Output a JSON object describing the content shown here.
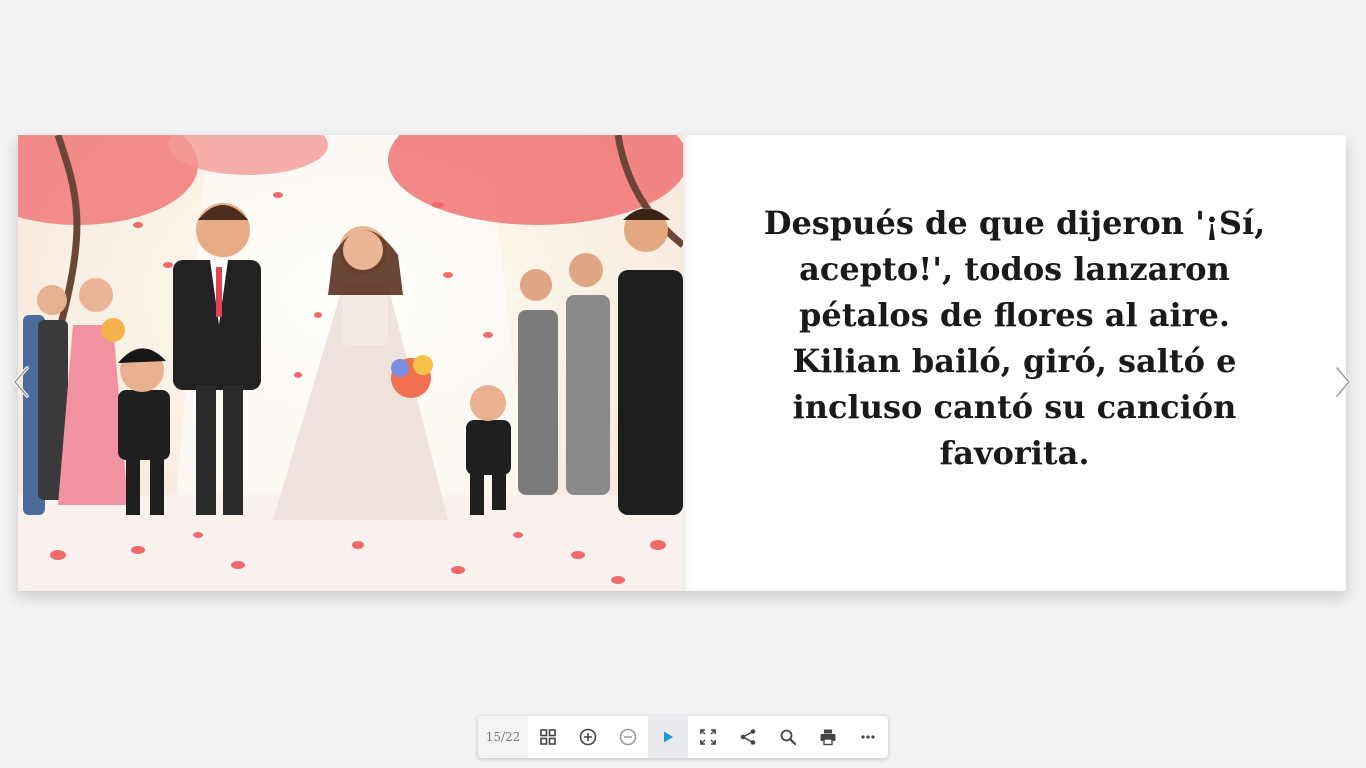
{
  "book": {
    "story_text": "Después de que dijeron '¡Sí, acepto!', todos lanzaron pétalos de flores al aire. Kilian bailó, giró, saltó e incluso cantó su canción favorita."
  },
  "illustration": {
    "description_icon": "wedding-illustration"
  },
  "toolbar": {
    "page_counter": "15/22",
    "buttons": [
      "grid-icon",
      "zoom-in-icon",
      "zoom-out-icon",
      "play-icon",
      "fullscreen-icon",
      "share-icon",
      "search-icon",
      "print-icon",
      "more-icon"
    ]
  },
  "colors": {
    "accent": "#1a9ad6",
    "petal": "#f06a6a",
    "background": "#f2f3f5"
  }
}
